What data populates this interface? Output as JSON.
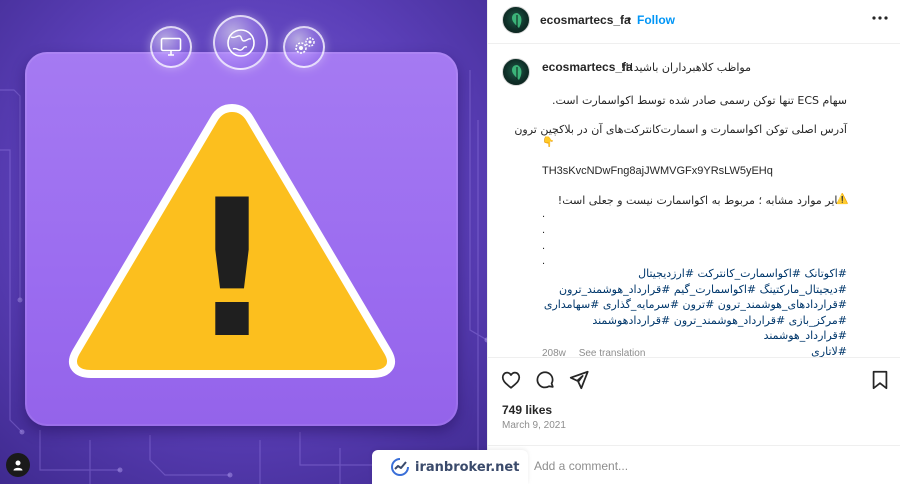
{
  "post": {
    "username": "ecosmartecs_fa",
    "separator": "•",
    "follow_label": "Follow",
    "more_icon": "more-horizontal-icon"
  },
  "caption": {
    "username": "ecosmartecs_fa",
    "line1": "مواظب کلاهبرداران باشید!!!",
    "line2": "سهام ECS تنها توکن رسمی صادر شده توسط اکواسمارت است.",
    "line3": "آدرس اصلی توکن اکواسمارت و اسمارت‌کانترکت‌های آن در بلاکچین ترون",
    "pointer_emoji": "👇",
    "address": "TH3sKvcNDwFng8ajJWMVGFx9YRsLW5yEHq",
    "line4": "سایر موارد مشابه ؛ مربوط به اکواسمارت نیست و جعلی است!",
    "warning_emoji": "⚠️",
    "dots": [
      ".",
      ".",
      ".",
      "."
    ],
    "hashtags": [
      "#اکوتانک #اکواسمارت_کانترکت #ارزدیجیتال",
      "#دیجیتال_مارکتینگ #اکواسمارت_گیم #قرارداد_هوشمند_ترون",
      "#قراردادهای_هوشمند_ترون #ترون #سرمایه_گذاری #سهامداری",
      "#مرکز_بازی #قرارداد_هوشمند_ترون #قراردادهوشمند #قرارداد_هوشمند",
      "#لاتاری"
    ],
    "time_ago": "208w",
    "see_translation": "See translation"
  },
  "actions": {
    "like_icon": "heart-icon",
    "comment_icon": "comment-icon",
    "share_icon": "share-icon",
    "save_icon": "bookmark-icon"
  },
  "stats": {
    "likes": "749 likes",
    "date": "March 9, 2021"
  },
  "comment": {
    "placeholder": "Add a comment..."
  },
  "watermark": {
    "text": "iranbroker.net"
  },
  "media": {
    "bubble_icons": [
      "monitor-icon",
      "globe-icon",
      "gears-icon"
    ],
    "symbol": "!",
    "colors": {
      "background": "#5b3fb8",
      "card": "#9b6cf0",
      "triangle": "#fcbf1e",
      "triangle_border": "#ffffff",
      "exclamation": "#1f1f1f"
    }
  },
  "colors": {
    "follow": "#0095f6",
    "hashtag": "#00376b",
    "muted": "#8e8e8e"
  }
}
